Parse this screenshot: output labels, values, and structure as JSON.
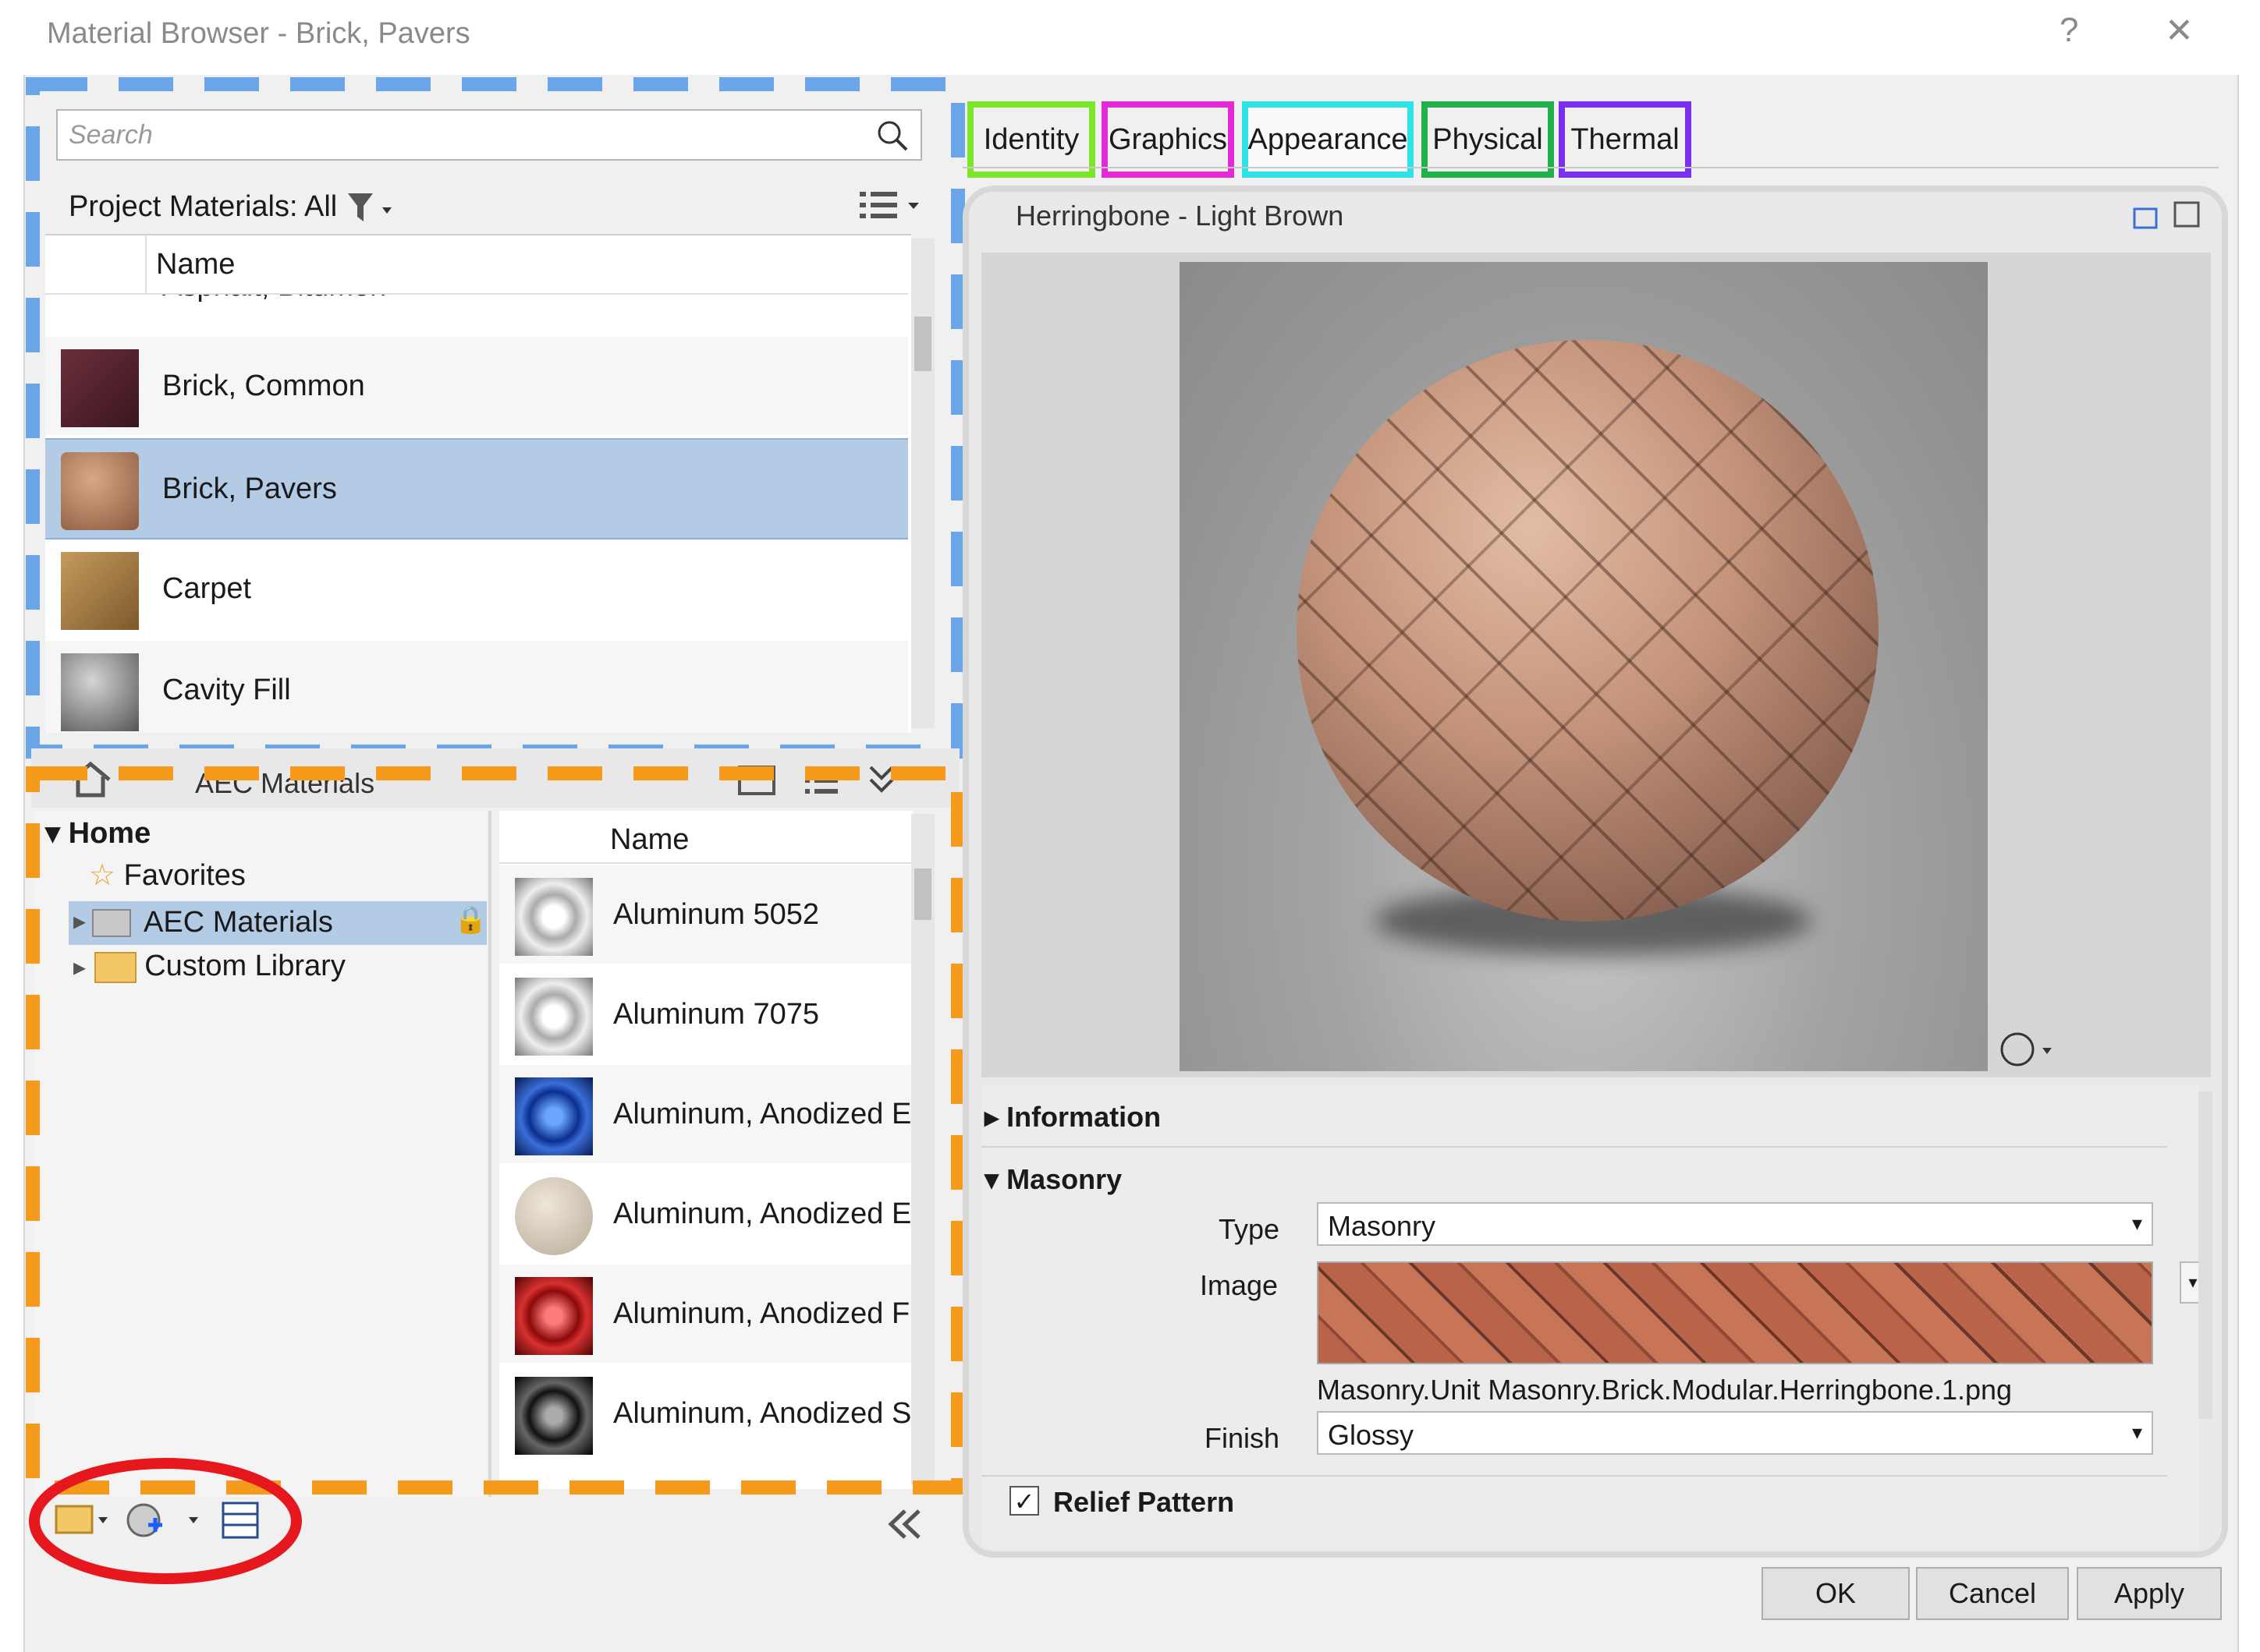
{
  "window": {
    "title": "Material Browser - Brick, Pavers",
    "help": "?",
    "close": "✕"
  },
  "search": {
    "placeholder": "Search"
  },
  "project": {
    "filter_label": "Project Materials: All",
    "column_name": "Name",
    "items": [
      {
        "label": "Asphalt, Bitumen"
      },
      {
        "label": "Brick, Common"
      },
      {
        "label": "Brick, Pavers"
      },
      {
        "label": "Carpet"
      },
      {
        "label": "Cavity Fill"
      }
    ]
  },
  "library": {
    "breadcrumb": "AEC Materials",
    "tree": {
      "home": "Home",
      "favorites": "Favorites",
      "aec": "AEC Materials",
      "custom": "Custom Library"
    },
    "column_name": "Name",
    "items": [
      {
        "label": "Aluminum 5052"
      },
      {
        "label": "Aluminum 7075"
      },
      {
        "label": "Aluminum, Anodized E"
      },
      {
        "label": "Aluminum, Anodized E"
      },
      {
        "label": "Aluminum, Anodized F"
      },
      {
        "label": "Aluminum, Anodized S"
      }
    ]
  },
  "tabs": [
    {
      "label": "Identity",
      "color": "#7ce62c"
    },
    {
      "label": "Graphics",
      "color": "#e22bd6"
    },
    {
      "label": "Appearance",
      "color": "#2ee3e6"
    },
    {
      "label": "Physical",
      "color": "#22b04b"
    },
    {
      "label": "Thermal",
      "color": "#7b2ff0"
    }
  ],
  "asset": {
    "name": "Herringbone - Light Brown"
  },
  "properties": {
    "information": "Information",
    "masonry": "Masonry",
    "type_label": "Type",
    "type_value": "Masonry",
    "image_label": "Image",
    "image_file": "Masonry.Unit Masonry.Brick.Modular.Herringbone.1.png",
    "finish_label": "Finish",
    "finish_value": "Glossy",
    "relief": "Relief Pattern"
  },
  "buttons": {
    "ok": "OK",
    "cancel": "Cancel",
    "apply": "Apply"
  },
  "colors": {
    "project_outline": "#6aa5e8",
    "library_outline": "#f59a1a",
    "tools_outline": "#e6171d",
    "selection": "#b4cbe6"
  }
}
